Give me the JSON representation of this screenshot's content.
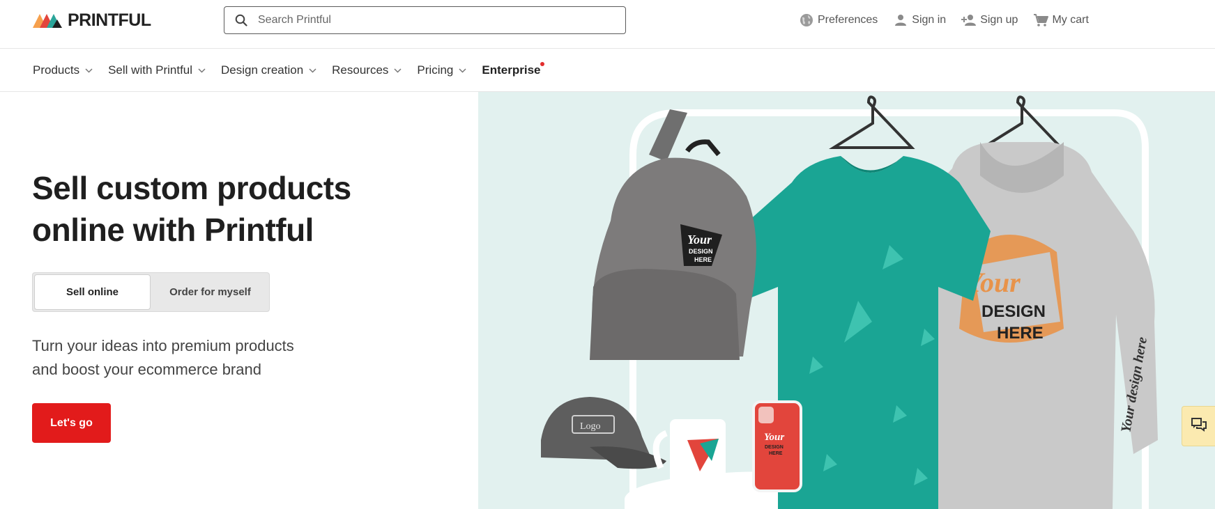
{
  "brand": {
    "name": "PRINTFUL",
    "accent": "#e21b1b",
    "hero_bg": "#e2f1ef"
  },
  "search": {
    "placeholder": "Search Printful",
    "value": ""
  },
  "account": {
    "preferences": "Preferences",
    "sign_in": "Sign in",
    "sign_up": "Sign up",
    "cart": "My cart"
  },
  "nav": {
    "items": [
      {
        "label": "Products",
        "icon": "chevron-down-icon"
      },
      {
        "label": "Sell with Printful",
        "icon": "chevron-down-icon"
      },
      {
        "label": "Design creation",
        "icon": "chevron-down-icon"
      },
      {
        "label": "Resources",
        "icon": "chevron-down-icon"
      },
      {
        "label": "Pricing",
        "icon": "chevron-down-icon"
      }
    ],
    "enterprise": "Enterprise"
  },
  "hero": {
    "title_line1": "Sell custom products",
    "title_line2": "online with Printful",
    "toggle": {
      "active": "Sell online",
      "inactive": "Order for myself"
    },
    "subtitle_line1": "Turn your ideas into premium products",
    "subtitle_line2": "and boost your ecommerce brand",
    "cta": "Let's go"
  },
  "product_image": {
    "backpack_print": [
      "Your",
      "DESIGN",
      "HERE"
    ],
    "hoodie_print": [
      "Your",
      "DESIGN",
      "HERE"
    ],
    "sleeve_print": "Your design here",
    "cap_print": "Logo",
    "phone_print": [
      "Your",
      "DESIGN",
      "HERE"
    ]
  },
  "chat": {
    "icon": "chat-icon"
  }
}
